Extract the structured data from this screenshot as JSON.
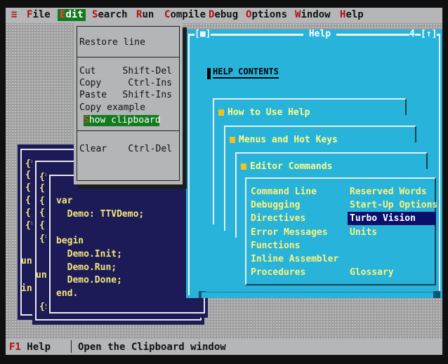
{
  "menubar": {
    "system": "≡",
    "items": [
      {
        "key": "F",
        "rest": "ile"
      },
      {
        "key": "E",
        "rest": "dit"
      },
      {
        "key": "S",
        "rest": "earch"
      },
      {
        "key": "R",
        "rest": "un"
      },
      {
        "key": "C",
        "rest": "ompile"
      },
      {
        "key": "D",
        "rest": "ebug"
      },
      {
        "key": "O",
        "rest": "ptions"
      },
      {
        "key": "W",
        "rest": "indow"
      },
      {
        "key": "H",
        "rest": "elp"
      }
    ]
  },
  "edit_menu": {
    "restore": "Restore line",
    "cut": "Cut",
    "cut_key": "Shift-Del",
    "copy": "Copy",
    "copy_key": "Ctrl-Ins",
    "paste": "Paste",
    "paste_key": "Shift-Ins",
    "copy_example": "Copy example",
    "show_clip_key": "S",
    "show_clip_rest": "how clipboard",
    "clear": "Clear",
    "clear_key": "Ctrl-Del"
  },
  "editor": {
    "back_lines": [
      "{*",
      "{",
      "{",
      "{",
      "{",
      "{*",
      "un",
      "",
      "in"
    ],
    "mid_lines": [
      "{*",
      "{",
      "{",
      "{",
      "{",
      "{",
      "{*",
      "",
      "un",
      "",
      "{$"
    ],
    "code_lines": [
      "",
      "",
      "var",
      "  Demo: TTVDemo;",
      "",
      "begin",
      "  Demo.Init;",
      "  Demo.Run;",
      "  Demo.Done;",
      "end."
    ]
  },
  "help_window": {
    "close_box": "[■]",
    "title": " Help ",
    "number": "4",
    "zoom_box": "[↑]",
    "contents_title": "HELP CONTENTS",
    "tab1": "How to Use Help",
    "tab2": "Menus and Hot Keys",
    "tab3": "Editor Commands",
    "topics_left": [
      "Command Line",
      "Debugging",
      "Directives",
      "Error Messages",
      "Functions",
      "Inline Assembler",
      "Procedures"
    ],
    "topics_right": [
      "Reserved Words",
      "Start-Up Options",
      "Turbo Vision",
      "Units",
      "",
      "",
      "Glossary"
    ],
    "selected_topic": "Turbo Vision"
  },
  "status": {
    "f1_key": "F1",
    "f1_label": " Help",
    "message": "Open the Clipboard window"
  },
  "colors": {
    "desktop": "#9e9e9e",
    "editor_bg": "#1d1a58",
    "help_bg": "#27b3da",
    "menu_highlight": "#137a1d"
  }
}
